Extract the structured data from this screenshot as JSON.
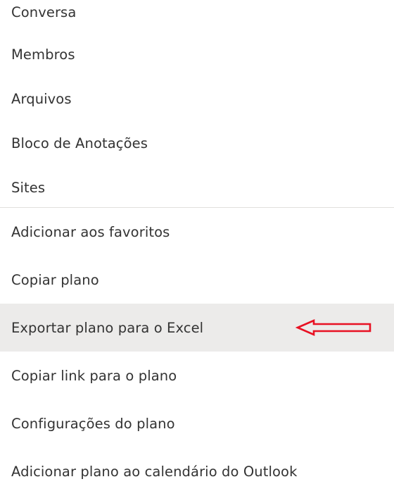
{
  "menu": {
    "items_top": [
      {
        "label": "Conversa"
      },
      {
        "label": "Membros"
      },
      {
        "label": "Arquivos"
      },
      {
        "label": "Bloco de Anotações"
      },
      {
        "label": "Sites"
      }
    ],
    "items_bottom": [
      {
        "label": "Adicionar aos favoritos"
      },
      {
        "label": "Copiar plano"
      },
      {
        "label": "Exportar plano para o Excel",
        "highlighted": true
      },
      {
        "label": "Copiar link para o plano"
      },
      {
        "label": "Configurações do plano"
      },
      {
        "label": "Adicionar plano ao calendário do Outlook"
      }
    ]
  },
  "annotation": {
    "icon": "red-arrow-left-icon",
    "color": "#e81123"
  },
  "colors": {
    "text": "#333333",
    "highlight_bg": "#ecebea",
    "divider": "#e1dfdd"
  }
}
